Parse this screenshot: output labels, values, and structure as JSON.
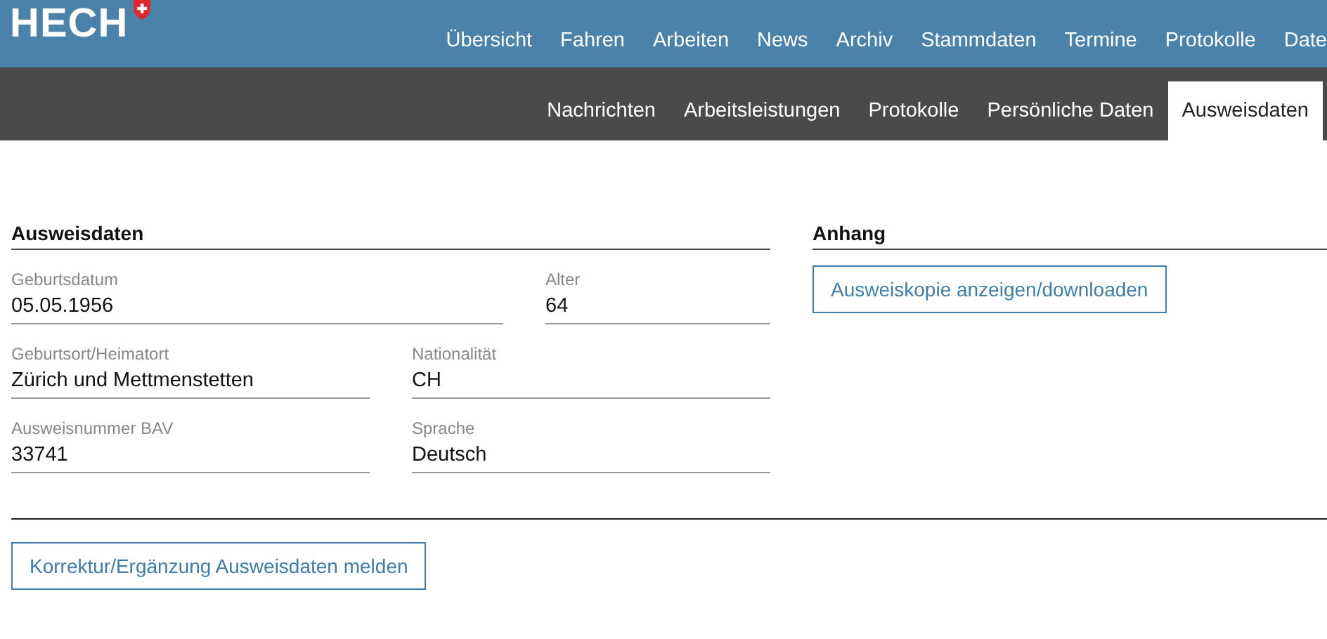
{
  "header": {
    "logo": "HECH",
    "nav": [
      {
        "label": "Übersicht",
        "selected": false
      },
      {
        "label": "Fahren",
        "selected": false
      },
      {
        "label": "Arbeiten",
        "selected": false
      },
      {
        "label": "News",
        "selected": false
      },
      {
        "label": "Archiv",
        "selected": false
      },
      {
        "label": "Stammdaten",
        "selected": false
      },
      {
        "label": "Termine",
        "selected": false
      },
      {
        "label": "Protokolle",
        "selected": false
      },
      {
        "label": "Date",
        "selected": false
      }
    ]
  },
  "subnav": [
    {
      "label": "Nachrichten",
      "selected": false
    },
    {
      "label": "Arbeitsleistungen",
      "selected": false
    },
    {
      "label": "Protokolle",
      "selected": false
    },
    {
      "label": "Persönliche Daten",
      "selected": false
    },
    {
      "label": "Ausweisdaten",
      "selected": true
    }
  ],
  "id_section": {
    "title": "Ausweisdaten",
    "rows": [
      [
        {
          "label": "Geburtsdatum",
          "value": "05.05.1956"
        },
        {
          "label": "Alter",
          "value": "64"
        }
      ],
      [
        {
          "label": "Geburtsort/Heimatort",
          "value": "Zürich und Mettmenstetten"
        },
        {
          "label": "Nationalität",
          "value": "CH"
        }
      ],
      [
        {
          "label": "Ausweisnummer BAV",
          "value": "33741"
        },
        {
          "label": "Sprache",
          "value": "Deutsch"
        }
      ]
    ]
  },
  "attachment": {
    "title": "Anhang",
    "button": "Ausweiskopie anzeigen/downloaden"
  },
  "footer_button": "Korrektur/Ergänzung Ausweisdaten melden"
}
